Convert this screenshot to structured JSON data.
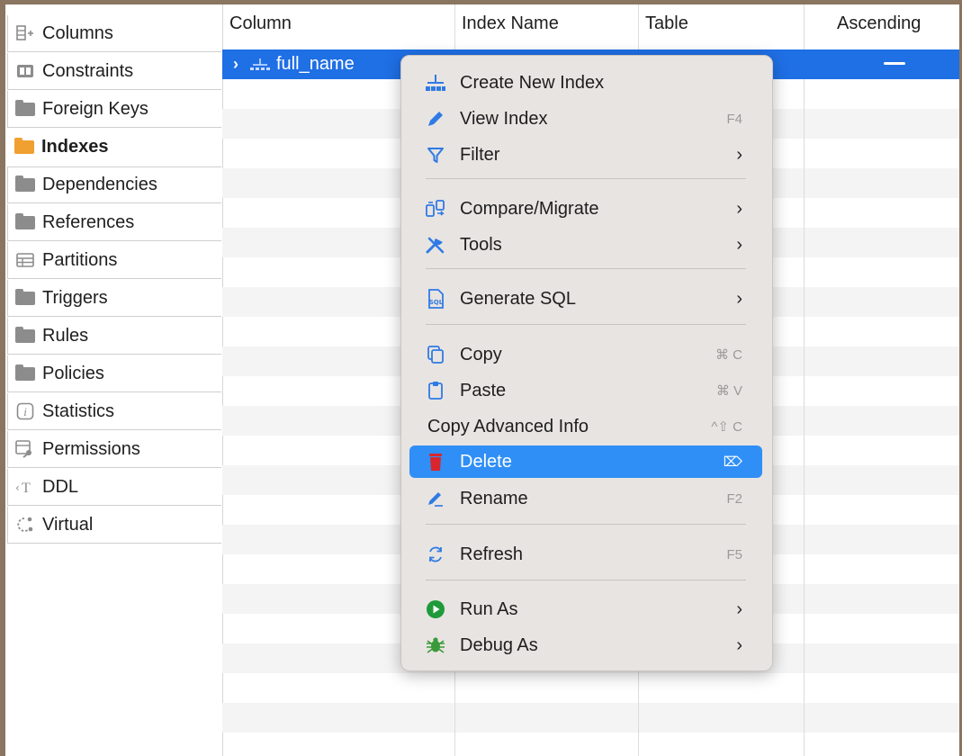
{
  "sidebar": {
    "items": [
      {
        "label": "Columns",
        "icon": "columns-icon"
      },
      {
        "label": "Constraints",
        "icon": "constraints-icon"
      },
      {
        "label": "Foreign Keys",
        "icon": "folder-icon"
      },
      {
        "label": "Indexes",
        "icon": "folder-icon",
        "active": true
      },
      {
        "label": "Dependencies",
        "icon": "folder-icon"
      },
      {
        "label": "References",
        "icon": "folder-icon"
      },
      {
        "label": "Partitions",
        "icon": "partitions-icon"
      },
      {
        "label": "Triggers",
        "icon": "folder-icon"
      },
      {
        "label": "Rules",
        "icon": "folder-icon"
      },
      {
        "label": "Policies",
        "icon": "folder-icon"
      },
      {
        "label": "Statistics",
        "icon": "info-icon"
      },
      {
        "label": "Permissions",
        "icon": "permissions-icon"
      },
      {
        "label": "DDL",
        "icon": "ddl-icon"
      },
      {
        "label": "Virtual",
        "icon": "virtual-icon"
      }
    ]
  },
  "table": {
    "headers": [
      "Column",
      "Index Name",
      "Table",
      "Ascending"
    ],
    "selected_row": {
      "column": "full_name",
      "ascending": "—"
    }
  },
  "context_menu": {
    "items": {
      "create_index": {
        "label": "Create New Index"
      },
      "view_index": {
        "label": "View Index",
        "shortcut": "F4"
      },
      "filter": {
        "label": "Filter"
      },
      "compare": {
        "label": "Compare/Migrate"
      },
      "tools": {
        "label": "Tools"
      },
      "generate_sql": {
        "label": "Generate SQL"
      },
      "copy": {
        "label": "Copy",
        "shortcut": "⌘ C"
      },
      "paste": {
        "label": "Paste",
        "shortcut": "⌘ V"
      },
      "copy_adv": {
        "label": "Copy Advanced Info",
        "shortcut": "^⇧ C"
      },
      "delete": {
        "label": "Delete",
        "shortcut": "⌦"
      },
      "rename": {
        "label": "Rename",
        "shortcut": "F2"
      },
      "refresh": {
        "label": "Refresh",
        "shortcut": "F5"
      },
      "run_as": {
        "label": "Run As"
      },
      "debug_as": {
        "label": "Debug As"
      }
    },
    "submenu_arrow": "›"
  },
  "colors": {
    "accent": "#2f8ff7",
    "selection": "#1f6fe5",
    "active_folder": "#f0a030"
  }
}
